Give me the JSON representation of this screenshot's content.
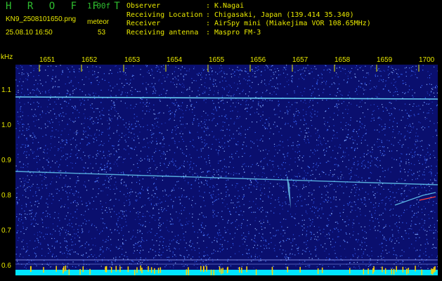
{
  "app": {
    "title": "H R O F F T",
    "version": "1.00f",
    "filename": "KN9_2508101650.png",
    "datetime": "25.08.10 16:50",
    "meteor_label": "meteor",
    "meteor_count": "53"
  },
  "info": [
    {
      "key": "Observer",
      "sep": ":",
      "value": "K.Nagai"
    },
    {
      "key": "Receiving Location",
      "sep": ":",
      "value": "Chigasaki, Japan (139.414 35.340)"
    },
    {
      "key": "Receiver",
      "sep": ":",
      "value": "AirSpy mini (Miakejima VOR 108.65MHz)"
    },
    {
      "key": "Receiving antenna",
      "sep": ":",
      "value": "Maspro FM-3"
    }
  ],
  "axes": {
    "freq_unit": "kHz",
    "time_ticks": [
      "1651",
      "1652",
      "1653",
      "1654",
      "1655",
      "1656",
      "1657",
      "1658",
      "1659",
      "1700"
    ],
    "freq_ticks": [
      "1.1",
      "1.0",
      "0.9",
      "0.8",
      "0.7",
      "0.6"
    ]
  },
  "colors": {
    "background": "#0a0f6e",
    "noise": "#3a6cff",
    "trace": "#6fe0ff",
    "label": "#e8e800",
    "title": "#2fbf2f",
    "baseline": "#00e5ff",
    "baseline_spike": "#ffd800"
  }
}
